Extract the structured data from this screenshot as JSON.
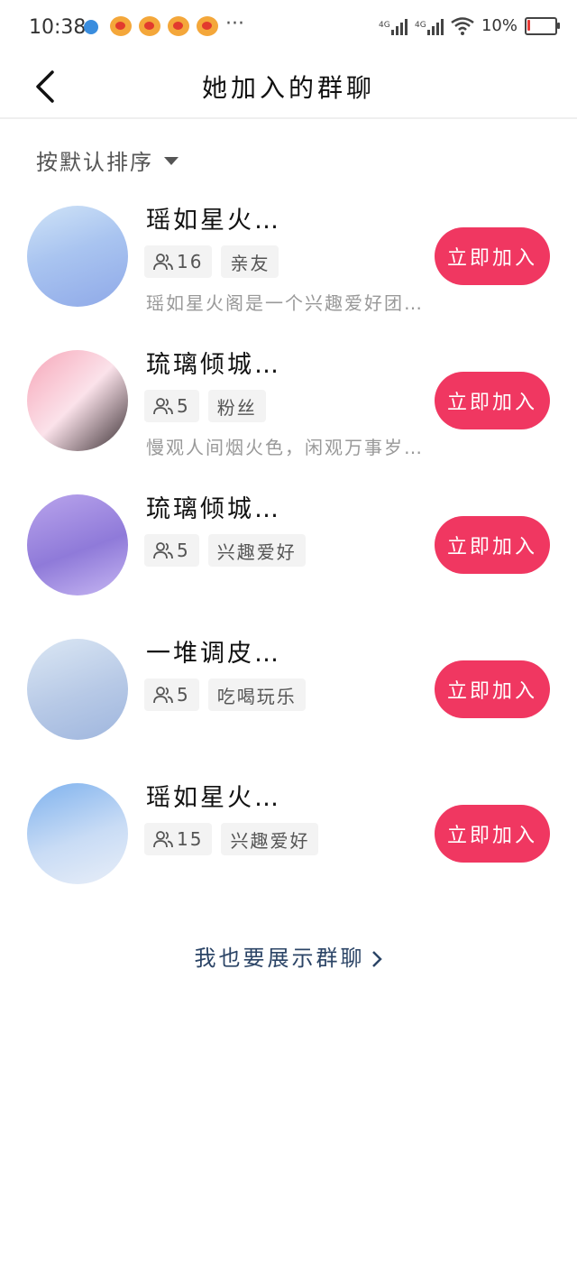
{
  "status_bar": {
    "time": "10:38",
    "battery_text": "10%",
    "battery_level": 0.1,
    "net_1": "4G",
    "net_2": "4G",
    "more": "···"
  },
  "nav": {
    "title": "她加入的群聊"
  },
  "sort": {
    "label": "按默认排序"
  },
  "join_label": "立即加入",
  "groups": [
    {
      "name": "瑶如星火…",
      "members": "16",
      "tag": "亲友",
      "desc": "瑶如星火阁是一个兴趣爱好团…"
    },
    {
      "name": "琉璃倾城…",
      "members": "5",
      "tag": "粉丝",
      "desc": "慢观人间烟火色，闲观万事岁…"
    },
    {
      "name": "琉璃倾城…",
      "members": "5",
      "tag": "兴趣爱好",
      "desc": ""
    },
    {
      "name": "一堆调皮…",
      "members": "5",
      "tag": "吃喝玩乐",
      "desc": ""
    },
    {
      "name": "瑶如星火…",
      "members": "15",
      "tag": "兴趣爱好",
      "desc": ""
    }
  ],
  "footer": {
    "link": "我也要展示群聊"
  },
  "colors": {
    "accent": "#f03761",
    "link": "#2b4466"
  }
}
